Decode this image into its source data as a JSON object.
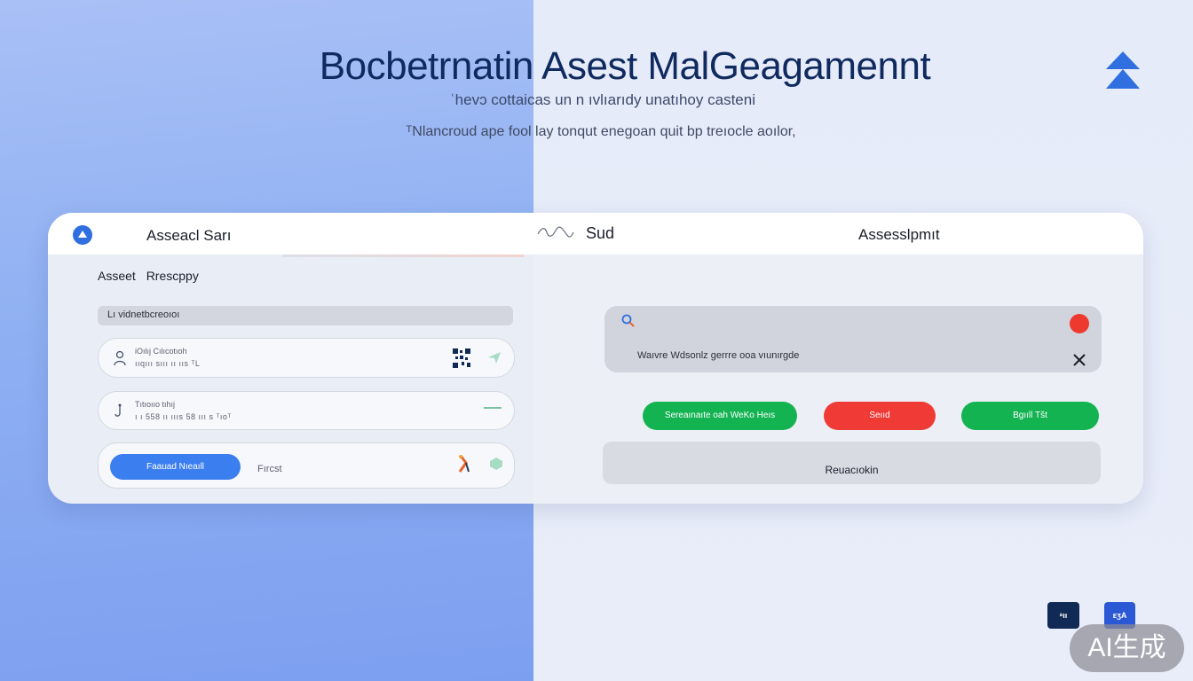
{
  "header": {
    "title": "Bocbetrnatin Asest MalGeagamennt",
    "subtitle": "ʿhevɔ cottaicas un n ıvlıarıdy  unatıhoy casteni",
    "tagline": "ᵀNlancroud ape fool lay tonqut enegoan quit bp treıocle aoılor,",
    "logo_icon": "double-chevron-up-icon"
  },
  "card": {
    "header": {
      "left_label": "Asseacl Sarı",
      "mid_label": "Sud",
      "right_label": "Assesslpmıt",
      "logo_icon": "brand-circle-icon"
    },
    "section_title": "Asseet Rrescppy",
    "filter_bar_text": "Lı vidnetbcreoıoı",
    "rows": [
      {
        "line1": "iOılıj Cılıcotıoh",
        "line2": "ııqııı sııı  ıı ııs ᵀL",
        "icon": "person-icon",
        "trailing_icon": "qr-icon",
        "action_icon": "arrow-icon"
      },
      {
        "line1": "Tıtıoııo tıhıj",
        "line2": "ı ı 558 ıı ıııs 58 ııı s ᵀıoᵀ",
        "icon": "hook-icon",
        "trailing_icon": "dash-icon"
      },
      {
        "button_label": "Faauad Nıeaıll",
        "text": "Fırcst",
        "trailing_icon": "figure-icon",
        "action_icon": "hexagon-icon"
      }
    ],
    "notice": {
      "message": "Waıvre Wdsonlz gerrre ooa vıunırgde",
      "search_icon": "search-icon",
      "status_color": "#ee3a2e",
      "close_icon": "close-icon"
    },
    "buttons": [
      {
        "label": "Sereaınaıte oah WeKo Heıs",
        "color": "#14b352"
      },
      {
        "label": "Seııd",
        "color": "#ef3a36"
      },
      {
        "label": "Bgııll Tšt",
        "color": "#14b352"
      }
    ],
    "result_label": "Reuacıokin"
  },
  "corner": {
    "mini_left": "ᵃıı",
    "mini_right": "ᴇʒA"
  },
  "watermark": "AI生成",
  "colors": {
    "accent_blue": "#3b7ef0",
    "navy": "#0f2a5e",
    "green": "#14b352",
    "red": "#ef3a36"
  }
}
